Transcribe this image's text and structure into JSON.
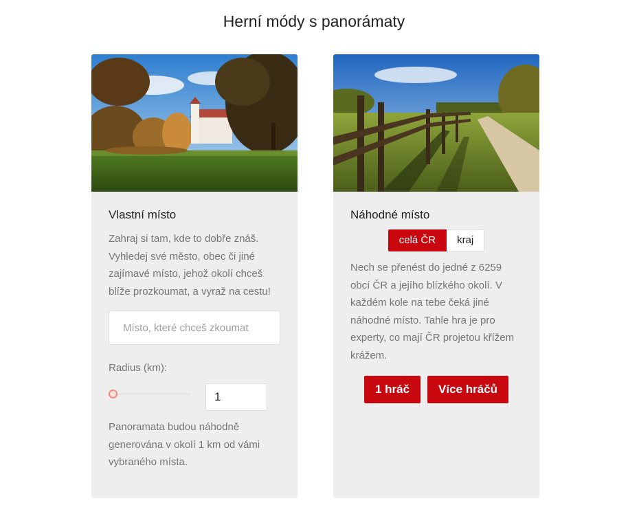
{
  "page": {
    "title": "Herní módy s panorámaty"
  },
  "colors": {
    "accent": "#c8070f",
    "card_bg": "#eeeeee",
    "muted_text": "#757575"
  },
  "custom_place": {
    "image": "castle-park-photo",
    "title": "Vlastní místo",
    "description": "Zahraj si tam, kde to dobře znáš. Vyhledej své město, obec či jiné zajímavé místo, jehož okolí chceš blíže prozkoumat, a vyraž na cestu!",
    "search": {
      "placeholder": "Místo, které chceš zkoumat",
      "value": ""
    },
    "radius": {
      "label": "Radius (km):",
      "value": "1",
      "slider_fraction": 0
    },
    "note": "Panoramata budou náhodně generována v okolí 1 km od vámi vybraného místa."
  },
  "random_place": {
    "image": "wooden-fence-path-photo",
    "title": "Náhodné místo",
    "region_toggle": {
      "options": [
        "celá ČR",
        "kraj"
      ],
      "selected": "celá ČR"
    },
    "description": "Nech se přenést do jedné z 6259 obcí ČR a jejího blízkého okolí. V každém kole na tebe čeká jiné náhodné místo. Tahle hra je pro experty, co mají ČR projetou křížem krážem.",
    "buttons": {
      "single_player": "1 hráč",
      "multi_player": "Více hráčů"
    }
  }
}
